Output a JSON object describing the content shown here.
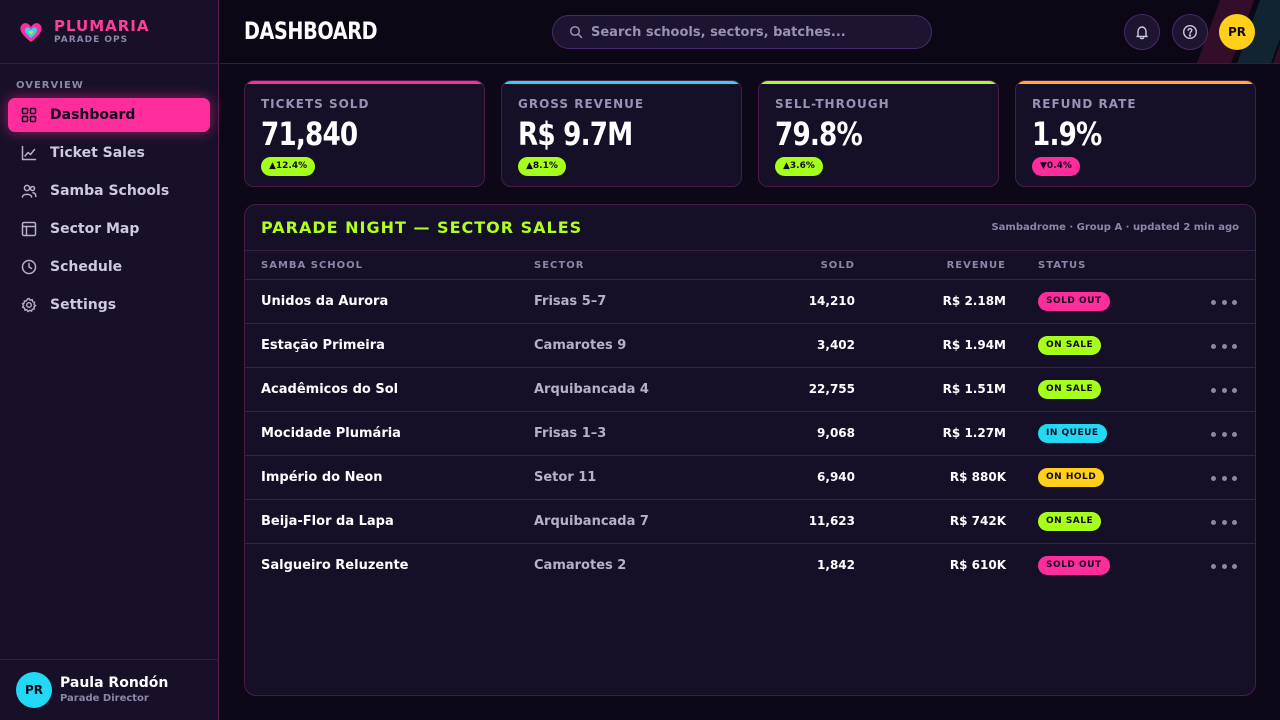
{
  "brand": {
    "name": "PLUMARIA",
    "subtitle": "PARADE OPS"
  },
  "sidebar": {
    "section_label": "OVERVIEW",
    "items": [
      {
        "label": "Dashboard",
        "icon": "grid-icon",
        "active": true
      },
      {
        "label": "Ticket Sales",
        "icon": "line-chart-icon",
        "active": false
      },
      {
        "label": "Samba Schools",
        "icon": "users-icon",
        "active": false
      },
      {
        "label": "Sector Map",
        "icon": "layout-icon",
        "active": false
      },
      {
        "label": "Schedule",
        "icon": "clock-icon",
        "active": false
      },
      {
        "label": "Settings",
        "icon": "gear-icon",
        "active": false
      }
    ]
  },
  "user": {
    "initials": "PR",
    "name": "Paula Rondón",
    "role": "Parade Director"
  },
  "header": {
    "title": "DASHBOARD",
    "search_placeholder": "Search schools, sectors, batches...",
    "avatar_initials": "PR"
  },
  "stats": [
    {
      "label": "TICKETS SOLD",
      "value": "71,840",
      "delta": "▲12.4%",
      "direction": "up",
      "accent": "#ff2d9b"
    },
    {
      "label": "GROSS REVENUE",
      "value": "R$ 9.7M",
      "delta": "▲8.1%",
      "direction": "up",
      "accent": "#22d8f2"
    },
    {
      "label": "SELL-THROUGH",
      "value": "79.8%",
      "delta": "▲3.6%",
      "direction": "up",
      "accent": "#a6ff1a"
    },
    {
      "label": "REFUND RATE",
      "value": "1.9%",
      "delta": "▼0.4%",
      "direction": "down",
      "accent": "#ffb21a"
    }
  ],
  "table": {
    "title": "PARADE NIGHT — SECTOR SALES",
    "meta": "Sambadrome · Group A · updated 2 min ago",
    "columns": {
      "school": "SAMBA SCHOOL",
      "sector": "SECTOR",
      "sold": "SOLD",
      "revenue": "REVENUE",
      "status": "STATUS"
    },
    "rows": [
      {
        "school": "Unidos da Aurora",
        "sector": "Frisas 5–7",
        "sold": "14,210",
        "revenue": "R$ 2.18M",
        "status": "SOLD OUT",
        "status_color": "#ff2d9b"
      },
      {
        "school": "Estação Primeira",
        "sector": "Camarotes 9",
        "sold": "3,402",
        "revenue": "R$ 1.94M",
        "status": "ON SALE",
        "status_color": "#a6ff1a"
      },
      {
        "school": "Acadêmicos do Sol",
        "sector": "Arquibancada 4",
        "sold": "22,755",
        "revenue": "R$ 1.51M",
        "status": "ON SALE",
        "status_color": "#a6ff1a"
      },
      {
        "school": "Mocidade Plumária",
        "sector": "Frisas 1–3",
        "sold": "9,068",
        "revenue": "R$ 1.27M",
        "status": "IN QUEUE",
        "status_color": "#22d8f2"
      },
      {
        "school": "Império do Neon",
        "sector": "Setor 11",
        "sold": "6,940",
        "revenue": "R$ 880K",
        "status": "ON HOLD",
        "status_color": "#ffcf1a"
      },
      {
        "school": "Beija-Flor da Lapa",
        "sector": "Arquibancada 7",
        "sold": "11,623",
        "revenue": "R$ 742K",
        "status": "ON SALE",
        "status_color": "#a6ff1a"
      },
      {
        "school": "Salgueiro Reluzente",
        "sector": "Camarotes 2",
        "sold": "1,842",
        "revenue": "R$ 610K",
        "status": "SOLD OUT",
        "status_color": "#ff2d9b"
      }
    ]
  }
}
